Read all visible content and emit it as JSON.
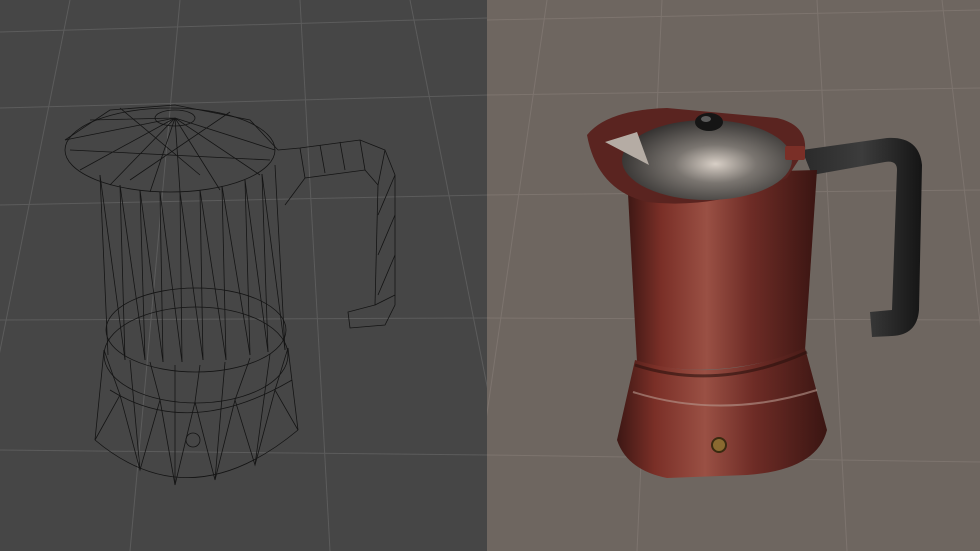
{
  "viewports": [
    {
      "mode": "wireframe",
      "object": "moka-pot",
      "background_color": "#464646",
      "grid_color": "#5c5c5c",
      "line_color": "#141414"
    },
    {
      "mode": "shaded",
      "object": "moka-pot",
      "background_color": "#6e6660",
      "grid_color": "#7d746e",
      "body_color": "#6e2c26",
      "handle_color": "#1e1e1e",
      "lid_color": "#4a4a4a"
    }
  ]
}
